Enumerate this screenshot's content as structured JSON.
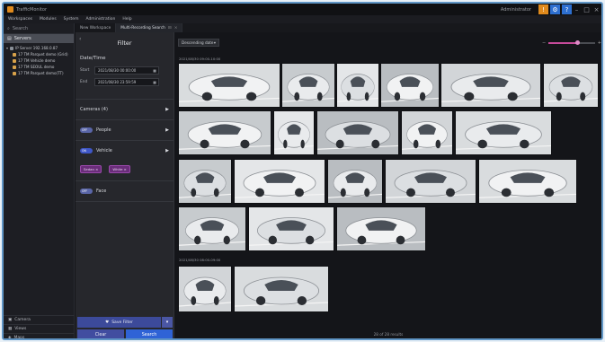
{
  "titlebar": {
    "title": "TrafficMonitor",
    "user": "Administrator"
  },
  "menu": [
    "Workspaces",
    "Modules",
    "System",
    "Administration",
    "Help"
  ],
  "tabs": [
    {
      "label": "New Workspace",
      "active": false
    },
    {
      "label": "Multi-Recording Search",
      "active": true
    }
  ],
  "left": {
    "search_label": "Search",
    "servers_label": "Servers",
    "tree": [
      {
        "label": "IP Server 192.168.0.87",
        "type": "server"
      },
      {
        "label": "17 TM Parquet demo (Grid)",
        "type": "cam"
      },
      {
        "label": "17 TM Vehicle demo",
        "type": "cam"
      },
      {
        "label": "17 TM SEOUL demo",
        "type": "cam"
      },
      {
        "label": "17 TM Parquet demo(TT)",
        "type": "cam"
      }
    ],
    "footer": [
      "Camera",
      "Views",
      "Maps"
    ]
  },
  "filter": {
    "title": "Filter",
    "date_section": "Date/Time",
    "start_label": "Start",
    "end_label": "End",
    "start_value": "2021/08/30  00:00:00",
    "end_value": "2021/08/30  23:59:59",
    "cameras_label": "Cameras (4)",
    "people_label": "People",
    "people_toggle": "OFF",
    "vehicle_label": "Vehicle",
    "vehicle_toggle": "ON",
    "vehicle_chips": [
      "Sedan",
      "White"
    ],
    "face_label": "Face",
    "face_toggle": "OFF",
    "save_label": "Save Filter",
    "clear_label": "Clear",
    "search_label": "Search"
  },
  "results": {
    "sort_label": "Descending date",
    "date_header_1": "2021/08/30 09:00-10:00",
    "date_header_2": "2021/08/30 08:00-09:00",
    "count_text": "28 of 28 results",
    "zoom_level": 0.62
  },
  "colors": {
    "accent": "#2f63d6",
    "border": "#5f95c5",
    "chip": "#6a2d7a"
  }
}
